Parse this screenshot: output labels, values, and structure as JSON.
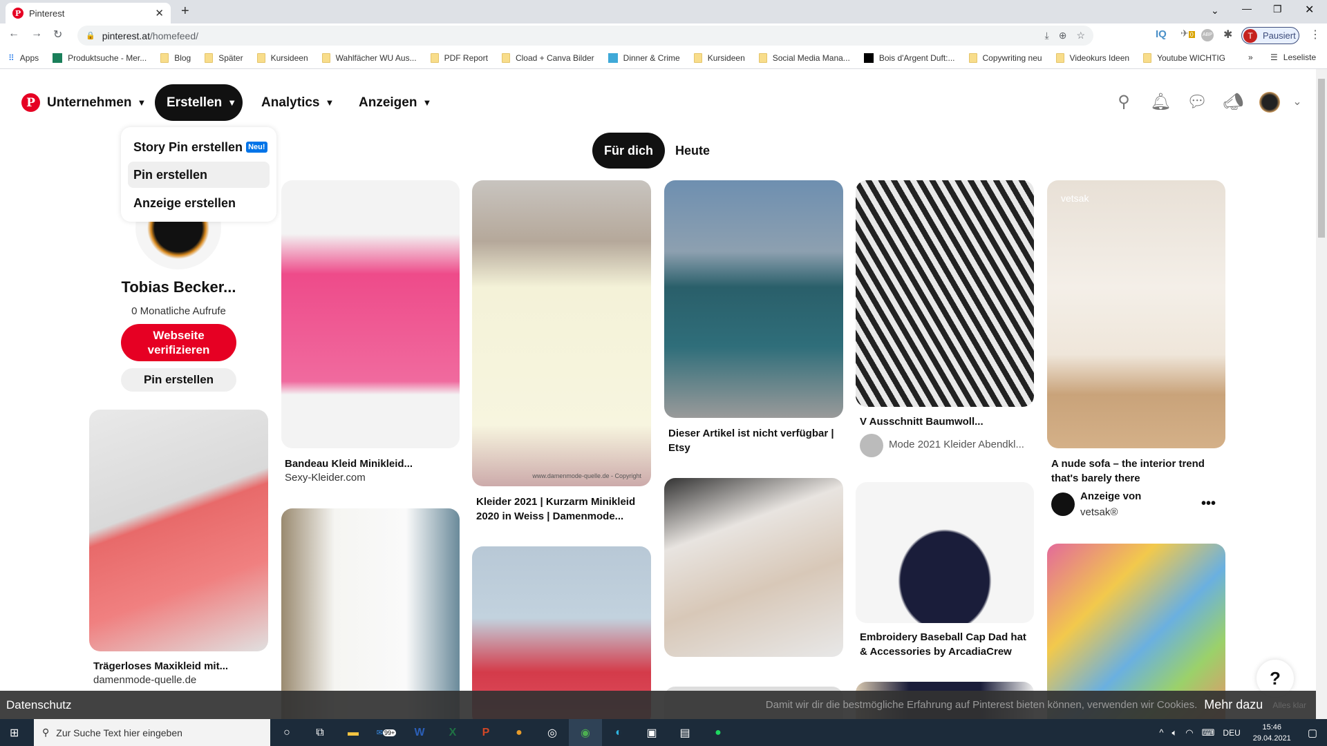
{
  "browser": {
    "tab_title": "Pinterest",
    "url_host": "pinterest.at",
    "url_path": "/homefeed/",
    "profile_label": "Pausiert",
    "profile_initial": "T",
    "ext_badge": "0",
    "bookmarks": [
      "Apps",
      "Produktsuche - Mer...",
      "Blog",
      "Später",
      "Kursideen",
      "Wahlfächer WU Aus...",
      "PDF Report",
      "Cload + Canva Bilder",
      "Dinner & Crime",
      "Kursideen",
      "Social Media Mana...",
      "Bois d'Argent Duft:...",
      "Copywriting neu",
      "Videokurs Ideen",
      "Youtube WICHTIG"
    ],
    "reading_list": "Leseliste"
  },
  "nav": {
    "business": "Unternehmen",
    "create": "Erstellen",
    "analytics": "Analytics",
    "ads": "Anzeigen"
  },
  "dropdown": {
    "items": [
      "Story Pin erstellen",
      "Pin erstellen",
      "Anzeige erstellen"
    ],
    "new_badge": "Neu!"
  },
  "feed_tabs": [
    "Für dich",
    "Heute"
  ],
  "profile": {
    "name": "Tobias Becker...",
    "views": "0 Monatliche Aufrufe",
    "verify": "Webseite verifizieren",
    "create_pin": "Pin erstellen"
  },
  "pins": [
    {
      "title": "Trägerloses Maxikleid mit...",
      "source": "damenmode-quelle.de"
    },
    {
      "title": "Bandeau Kleid Minikleid...",
      "source": "Sexy-Kleider.com"
    },
    {
      "title": "Kleider 2021 | Kurzarm Minikleid 2020 in Weiss | Damenmode...",
      "watermark": "www.damenmode-quelle.de - Copyright"
    },
    {
      "title": "Dieser Artikel ist nicht verfügbar | Etsy"
    },
    {
      "title": "V Ausschnitt Baumwoll...",
      "source": "Mode 2021 Kleider Abendkl..."
    },
    {
      "title": "A nude sofa – the interior trend that's barely there",
      "ad_label": "Anzeige von",
      "advertiser": "vetsak®",
      "image_label": "vetsak"
    },
    {
      "title": "Embroidery Baseball Cap Dad hat & Accessories by ArcadiaCrew"
    }
  ],
  "help": "?",
  "cookie": {
    "privacy": "Datenschutz",
    "message": "Damit wir dir die bestmögliche Erfahrung auf Pinterest bieten können, verwenden wir Cookies.",
    "more": "Mehr dazu",
    "ok": "Alles klar"
  },
  "taskbar": {
    "search_placeholder": "Zur Suche Text hier eingeben",
    "mail_badge": "99+",
    "lang": "DEU",
    "time": "15:46",
    "date": "29.04.2021"
  },
  "colors": {
    "brand": "#e60023",
    "badge": "#0074e8"
  }
}
